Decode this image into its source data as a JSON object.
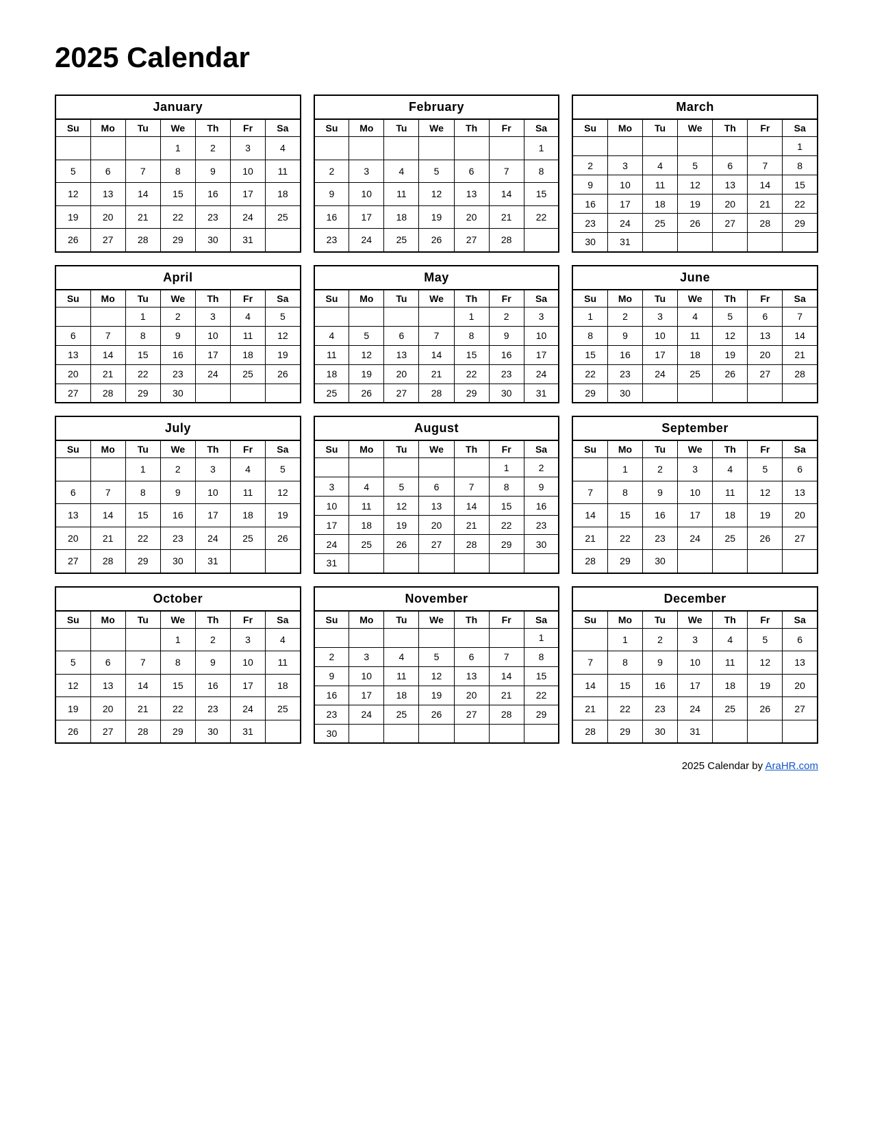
{
  "title": "2025 Calendar",
  "footer": {
    "text": "2025  Calendar by ",
    "link_label": "AraHR.com",
    "link_url": "AraHR.com"
  },
  "months": [
    {
      "name": "January",
      "weeks": [
        [
          "",
          "",
          "",
          "1",
          "2",
          "3",
          "4"
        ],
        [
          "5",
          "6",
          "7",
          "8",
          "9",
          "10",
          "11"
        ],
        [
          "12",
          "13",
          "14",
          "15",
          "16",
          "17",
          "18"
        ],
        [
          "19",
          "20",
          "21",
          "22",
          "23",
          "24",
          "25"
        ],
        [
          "26",
          "27",
          "28",
          "29",
          "30",
          "31",
          ""
        ]
      ]
    },
    {
      "name": "February",
      "weeks": [
        [
          "",
          "",
          "",
          "",
          "",
          "",
          "1"
        ],
        [
          "2",
          "3",
          "4",
          "5",
          "6",
          "7",
          "8"
        ],
        [
          "9",
          "10",
          "11",
          "12",
          "13",
          "14",
          "15"
        ],
        [
          "16",
          "17",
          "18",
          "19",
          "20",
          "21",
          "22"
        ],
        [
          "23",
          "24",
          "25",
          "26",
          "27",
          "28",
          ""
        ]
      ]
    },
    {
      "name": "March",
      "weeks": [
        [
          "",
          "",
          "",
          "",
          "",
          "",
          "1"
        ],
        [
          "2",
          "3",
          "4",
          "5",
          "6",
          "7",
          "8"
        ],
        [
          "9",
          "10",
          "11",
          "12",
          "13",
          "14",
          "15"
        ],
        [
          "16",
          "17",
          "18",
          "19",
          "20",
          "21",
          "22"
        ],
        [
          "23",
          "24",
          "25",
          "26",
          "27",
          "28",
          "29"
        ],
        [
          "30",
          "31",
          "",
          "",
          "",
          "",
          ""
        ]
      ]
    },
    {
      "name": "April",
      "weeks": [
        [
          "",
          "",
          "1",
          "2",
          "3",
          "4",
          "5"
        ],
        [
          "6",
          "7",
          "8",
          "9",
          "10",
          "11",
          "12"
        ],
        [
          "13",
          "14",
          "15",
          "16",
          "17",
          "18",
          "19"
        ],
        [
          "20",
          "21",
          "22",
          "23",
          "24",
          "25",
          "26"
        ],
        [
          "27",
          "28",
          "29",
          "30",
          "",
          "",
          ""
        ]
      ]
    },
    {
      "name": "May",
      "weeks": [
        [
          "",
          "",
          "",
          "",
          "1",
          "2",
          "3"
        ],
        [
          "4",
          "5",
          "6",
          "7",
          "8",
          "9",
          "10"
        ],
        [
          "11",
          "12",
          "13",
          "14",
          "15",
          "16",
          "17"
        ],
        [
          "18",
          "19",
          "20",
          "21",
          "22",
          "23",
          "24"
        ],
        [
          "25",
          "26",
          "27",
          "28",
          "29",
          "30",
          "31"
        ]
      ]
    },
    {
      "name": "June",
      "weeks": [
        [
          "1",
          "2",
          "3",
          "4",
          "5",
          "6",
          "7"
        ],
        [
          "8",
          "9",
          "10",
          "11",
          "12",
          "13",
          "14"
        ],
        [
          "15",
          "16",
          "17",
          "18",
          "19",
          "20",
          "21"
        ],
        [
          "22",
          "23",
          "24",
          "25",
          "26",
          "27",
          "28"
        ],
        [
          "29",
          "30",
          "",
          "",
          "",
          "",
          ""
        ]
      ]
    },
    {
      "name": "July",
      "weeks": [
        [
          "",
          "",
          "1",
          "2",
          "3",
          "4",
          "5"
        ],
        [
          "6",
          "7",
          "8",
          "9",
          "10",
          "11",
          "12"
        ],
        [
          "13",
          "14",
          "15",
          "16",
          "17",
          "18",
          "19"
        ],
        [
          "20",
          "21",
          "22",
          "23",
          "24",
          "25",
          "26"
        ],
        [
          "27",
          "28",
          "29",
          "30",
          "31",
          "",
          ""
        ]
      ]
    },
    {
      "name": "August",
      "weeks": [
        [
          "",
          "",
          "",
          "",
          "",
          "1",
          "2"
        ],
        [
          "3",
          "4",
          "5",
          "6",
          "7",
          "8",
          "9"
        ],
        [
          "10",
          "11",
          "12",
          "13",
          "14",
          "15",
          "16"
        ],
        [
          "17",
          "18",
          "19",
          "20",
          "21",
          "22",
          "23"
        ],
        [
          "24",
          "25",
          "26",
          "27",
          "28",
          "29",
          "30"
        ],
        [
          "31",
          "",
          "",
          "",
          "",
          "",
          ""
        ]
      ]
    },
    {
      "name": "September",
      "weeks": [
        [
          "",
          "1",
          "2",
          "3",
          "4",
          "5",
          "6"
        ],
        [
          "7",
          "8",
          "9",
          "10",
          "11",
          "12",
          "13"
        ],
        [
          "14",
          "15",
          "16",
          "17",
          "18",
          "19",
          "20"
        ],
        [
          "21",
          "22",
          "23",
          "24",
          "25",
          "26",
          "27"
        ],
        [
          "28",
          "29",
          "30",
          "",
          "",
          "",
          ""
        ]
      ]
    },
    {
      "name": "October",
      "weeks": [
        [
          "",
          "",
          "",
          "1",
          "2",
          "3",
          "4"
        ],
        [
          "5",
          "6",
          "7",
          "8",
          "9",
          "10",
          "11"
        ],
        [
          "12",
          "13",
          "14",
          "15",
          "16",
          "17",
          "18"
        ],
        [
          "19",
          "20",
          "21",
          "22",
          "23",
          "24",
          "25"
        ],
        [
          "26",
          "27",
          "28",
          "29",
          "30",
          "31",
          ""
        ]
      ]
    },
    {
      "name": "November",
      "weeks": [
        [
          "",
          "",
          "",
          "",
          "",
          "",
          "1"
        ],
        [
          "2",
          "3",
          "4",
          "5",
          "6",
          "7",
          "8"
        ],
        [
          "9",
          "10",
          "11",
          "12",
          "13",
          "14",
          "15"
        ],
        [
          "16",
          "17",
          "18",
          "19",
          "20",
          "21",
          "22"
        ],
        [
          "23",
          "24",
          "25",
          "26",
          "27",
          "28",
          "29"
        ],
        [
          "30",
          "",
          "",
          "",
          "",
          "",
          ""
        ]
      ]
    },
    {
      "name": "December",
      "weeks": [
        [
          "",
          "1",
          "2",
          "3",
          "4",
          "5",
          "6"
        ],
        [
          "7",
          "8",
          "9",
          "10",
          "11",
          "12",
          "13"
        ],
        [
          "14",
          "15",
          "16",
          "17",
          "18",
          "19",
          "20"
        ],
        [
          "21",
          "22",
          "23",
          "24",
          "25",
          "26",
          "27"
        ],
        [
          "28",
          "29",
          "30",
          "31",
          "",
          "",
          ""
        ]
      ]
    }
  ],
  "day_headers": [
    "Su",
    "Mo",
    "Tu",
    "We",
    "Th",
    "Fr",
    "Sa"
  ]
}
